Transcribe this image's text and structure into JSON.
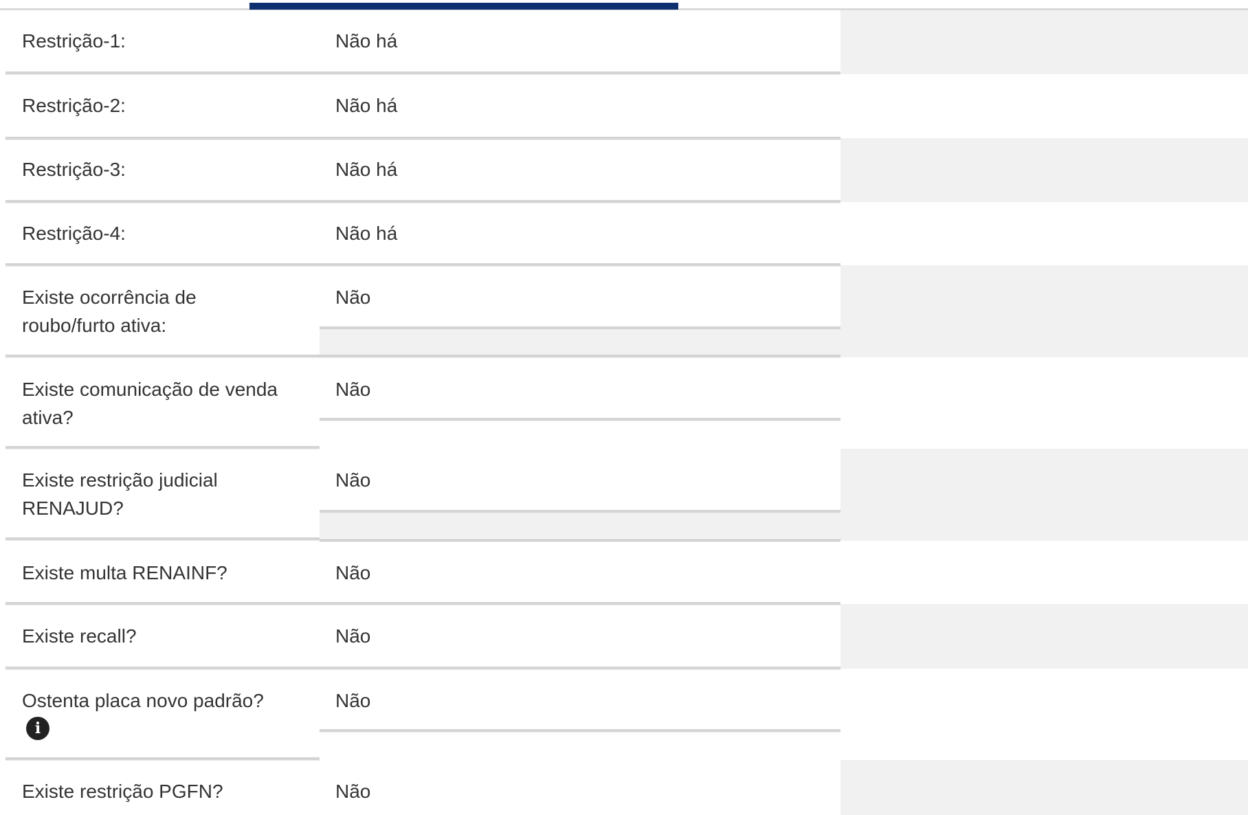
{
  "rows": [
    {
      "label": "Restrição-1:",
      "value": "Não há"
    },
    {
      "label": "Restrição-2:",
      "value": "Não há"
    },
    {
      "label": "Restrição-3:",
      "value": "Não há"
    },
    {
      "label": "Restrição-4:",
      "value": "Não há"
    },
    {
      "label": "Existe ocorrência de roubo/furto ativa:",
      "value": "Não"
    },
    {
      "label": "Existe comunicação de venda ativa?",
      "value": "Não"
    },
    {
      "label": "Existe restrição judicial RENAJUD?",
      "value": "Não"
    },
    {
      "label": "Existe multa RENAINF?",
      "value": "Não"
    },
    {
      "label": "Existe recall?",
      "value": "Não"
    },
    {
      "label": "Ostenta placa novo padrão?",
      "value": "Não",
      "icon": "info-icon"
    },
    {
      "label": "Existe restrição PGFN?",
      "value": "Não"
    }
  ],
  "colors": {
    "tab_indicator": "#0f3070",
    "row_stripe": "#f1f1f1",
    "divider": "#d4d4d4"
  }
}
